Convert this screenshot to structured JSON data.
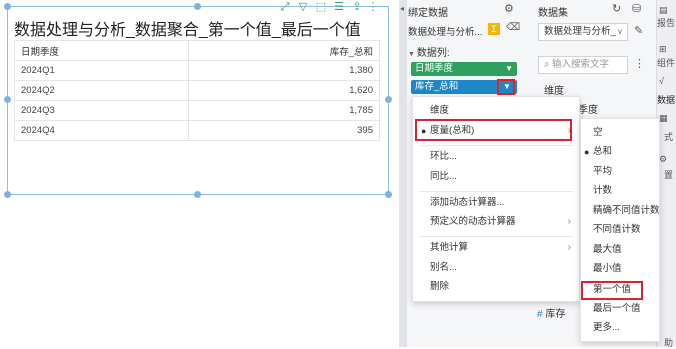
{
  "report": {
    "title": "数据处理与分析_数据聚合_第一个值_最后一个值",
    "table": {
      "columns": [
        "日期季度",
        "库存_总和"
      ],
      "rows": [
        [
          "2024Q1",
          "1,380"
        ],
        [
          "2024Q2",
          "1,620"
        ],
        [
          "2024Q3",
          "1,785"
        ],
        [
          "2024Q4",
          "395"
        ]
      ]
    }
  },
  "binding_panel": {
    "title": "绑定数据",
    "dataset_value": "数据处理与分析...",
    "data_columns_label": "数据列:",
    "fields": [
      "日期季度",
      "库存_总和"
    ]
  },
  "dataset_panel": {
    "title": "数据集",
    "dataset_value": "数据处理与分析_",
    "search_placeholder": "输入搜索文字",
    "dimension_label": "维度",
    "dimension_partial": "季度",
    "measure_item": "库存"
  },
  "context_menu": {
    "items": [
      {
        "label": "维度",
        "selected": false,
        "submenu": false
      },
      {
        "label": "度量(总和)",
        "selected": true,
        "submenu": true
      },
      {
        "label": "环比...",
        "selected": false,
        "submenu": false
      },
      {
        "label": "同比...",
        "selected": false,
        "submenu": false
      },
      {
        "label": "添加动态计算器...",
        "selected": false,
        "submenu": false
      },
      {
        "label": "预定义的动态计算器",
        "selected": false,
        "submenu": true
      },
      {
        "label": "其他计算",
        "selected": false,
        "submenu": true
      },
      {
        "label": "别名...",
        "selected": false,
        "submenu": false
      },
      {
        "label": "删除",
        "selected": false,
        "submenu": false
      }
    ]
  },
  "aggregation_menu": {
    "items": [
      {
        "label": "空",
        "selected": false
      },
      {
        "label": "总和",
        "selected": true
      },
      {
        "label": "平均",
        "selected": false
      },
      {
        "label": "计数",
        "selected": false
      },
      {
        "label": "精确不同值计数",
        "selected": false
      },
      {
        "label": "不同值计数",
        "selected": false
      },
      {
        "label": "最大值",
        "selected": false
      },
      {
        "label": "最小值",
        "selected": false
      },
      {
        "label": "第一个值",
        "selected": false
      },
      {
        "label": "最后一个值",
        "selected": false
      },
      {
        "label": "更多...",
        "selected": false
      }
    ]
  },
  "side_tabs": [
    "报告",
    "组件",
    "数据",
    "式",
    "置",
    "助"
  ],
  "colors": {
    "accent_green": "#2fa05e",
    "accent_blue": "#1f86c8",
    "highlight_red": "#d9232e",
    "selection_border": "#8fbde8"
  }
}
